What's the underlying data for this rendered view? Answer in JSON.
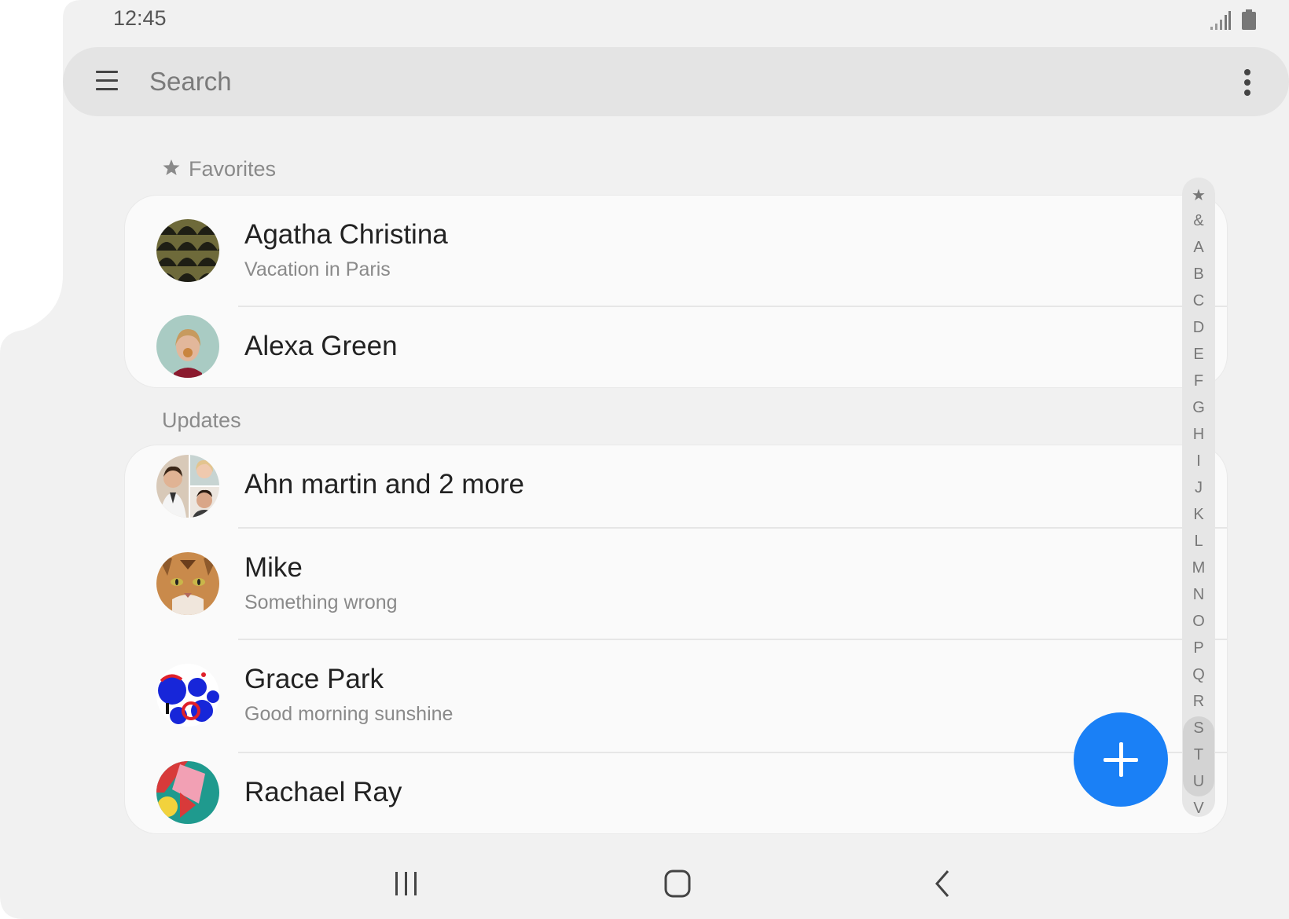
{
  "status_bar": {
    "time": "12:45"
  },
  "search": {
    "placeholder": "Search"
  },
  "sections": {
    "favorites": "Favorites",
    "updates": "Updates"
  },
  "favorites": [
    {
      "name": "Agatha Christina",
      "status": "Vacation in Paris"
    },
    {
      "name": "Alexa Green"
    }
  ],
  "updates": [
    {
      "name": "Ahn martin and 2 more"
    },
    {
      "name": "Mike",
      "status": "Something wrong"
    },
    {
      "name": "Grace Park",
      "status": "Good morning sunshine"
    },
    {
      "name": "Rachael Ray"
    }
  ],
  "index_letters": [
    "★",
    "&",
    "A",
    "B",
    "C",
    "D",
    "E",
    "F",
    "G",
    "H",
    "I",
    "J",
    "K",
    "L",
    "M",
    "N",
    "O",
    "P",
    "Q",
    "R",
    "S",
    "T",
    "U",
    "V"
  ],
  "icons": {
    "menu": "menu-icon",
    "more": "more-vert-icon",
    "star": "star-icon",
    "add": "plus-icon",
    "signal": "signal-icon",
    "battery": "battery-icon",
    "recents": "recents-icon",
    "home": "home-icon",
    "back": "back-icon"
  },
  "colors": {
    "accent": "#1a80f6",
    "background": "#f1f1f1",
    "card": "#fafafa"
  }
}
